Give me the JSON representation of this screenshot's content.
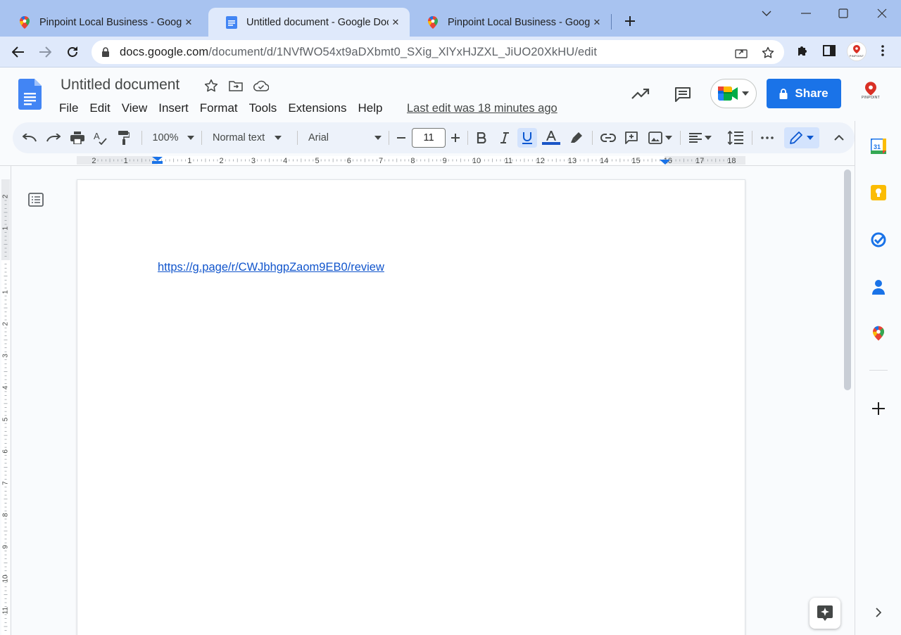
{
  "browser": {
    "tabs": [
      {
        "title": "Pinpoint Local Business - Google",
        "favicon": "google-maps-pin-icon",
        "active": false
      },
      {
        "title": "Untitled document - Google Docs",
        "favicon": "google-docs-icon",
        "active": true
      },
      {
        "title": "Pinpoint Local Business - Google",
        "favicon": "google-maps-pin-icon",
        "active": false
      }
    ],
    "url": {
      "host": "docs.google.com",
      "path": "/document/d/1NVfWO54xt9aDXbmt0_SXig_XlYxHJZXL_JiUO20XkHU/edit"
    },
    "profile_label": "PINPOINT"
  },
  "doc": {
    "title": "Untitled document",
    "menu": [
      "File",
      "Edit",
      "View",
      "Insert",
      "Format",
      "Tools",
      "Extensions",
      "Help"
    ],
    "last_edit": "Last edit was 18 minutes ago",
    "share_label": "Share",
    "account_label": "PINPOINT"
  },
  "toolbar": {
    "zoom": "100%",
    "style": "Normal text",
    "font": "Arial",
    "font_size": "11",
    "text_color": "#1a56c7"
  },
  "ruler": {
    "h_labels": [
      "2",
      "1",
      "1",
      "2",
      "3",
      "4",
      "5",
      "6",
      "7",
      "8",
      "9",
      "10",
      "11",
      "12",
      "13",
      "14",
      "15",
      "16",
      "17",
      "18"
    ],
    "v_labels": [
      "2",
      "1",
      "1",
      "2",
      "3",
      "4",
      "5",
      "6",
      "7",
      "8",
      "9",
      "10",
      "11"
    ]
  },
  "content": {
    "link_text": "https://g.page/r/CWJbhgpZaom9EB0/review"
  },
  "colors": {
    "accent": "#1a73e8",
    "link": "#1155cc",
    "tabstrip": "#a8c3f0",
    "toolbar_bg": "#edf2fa"
  }
}
